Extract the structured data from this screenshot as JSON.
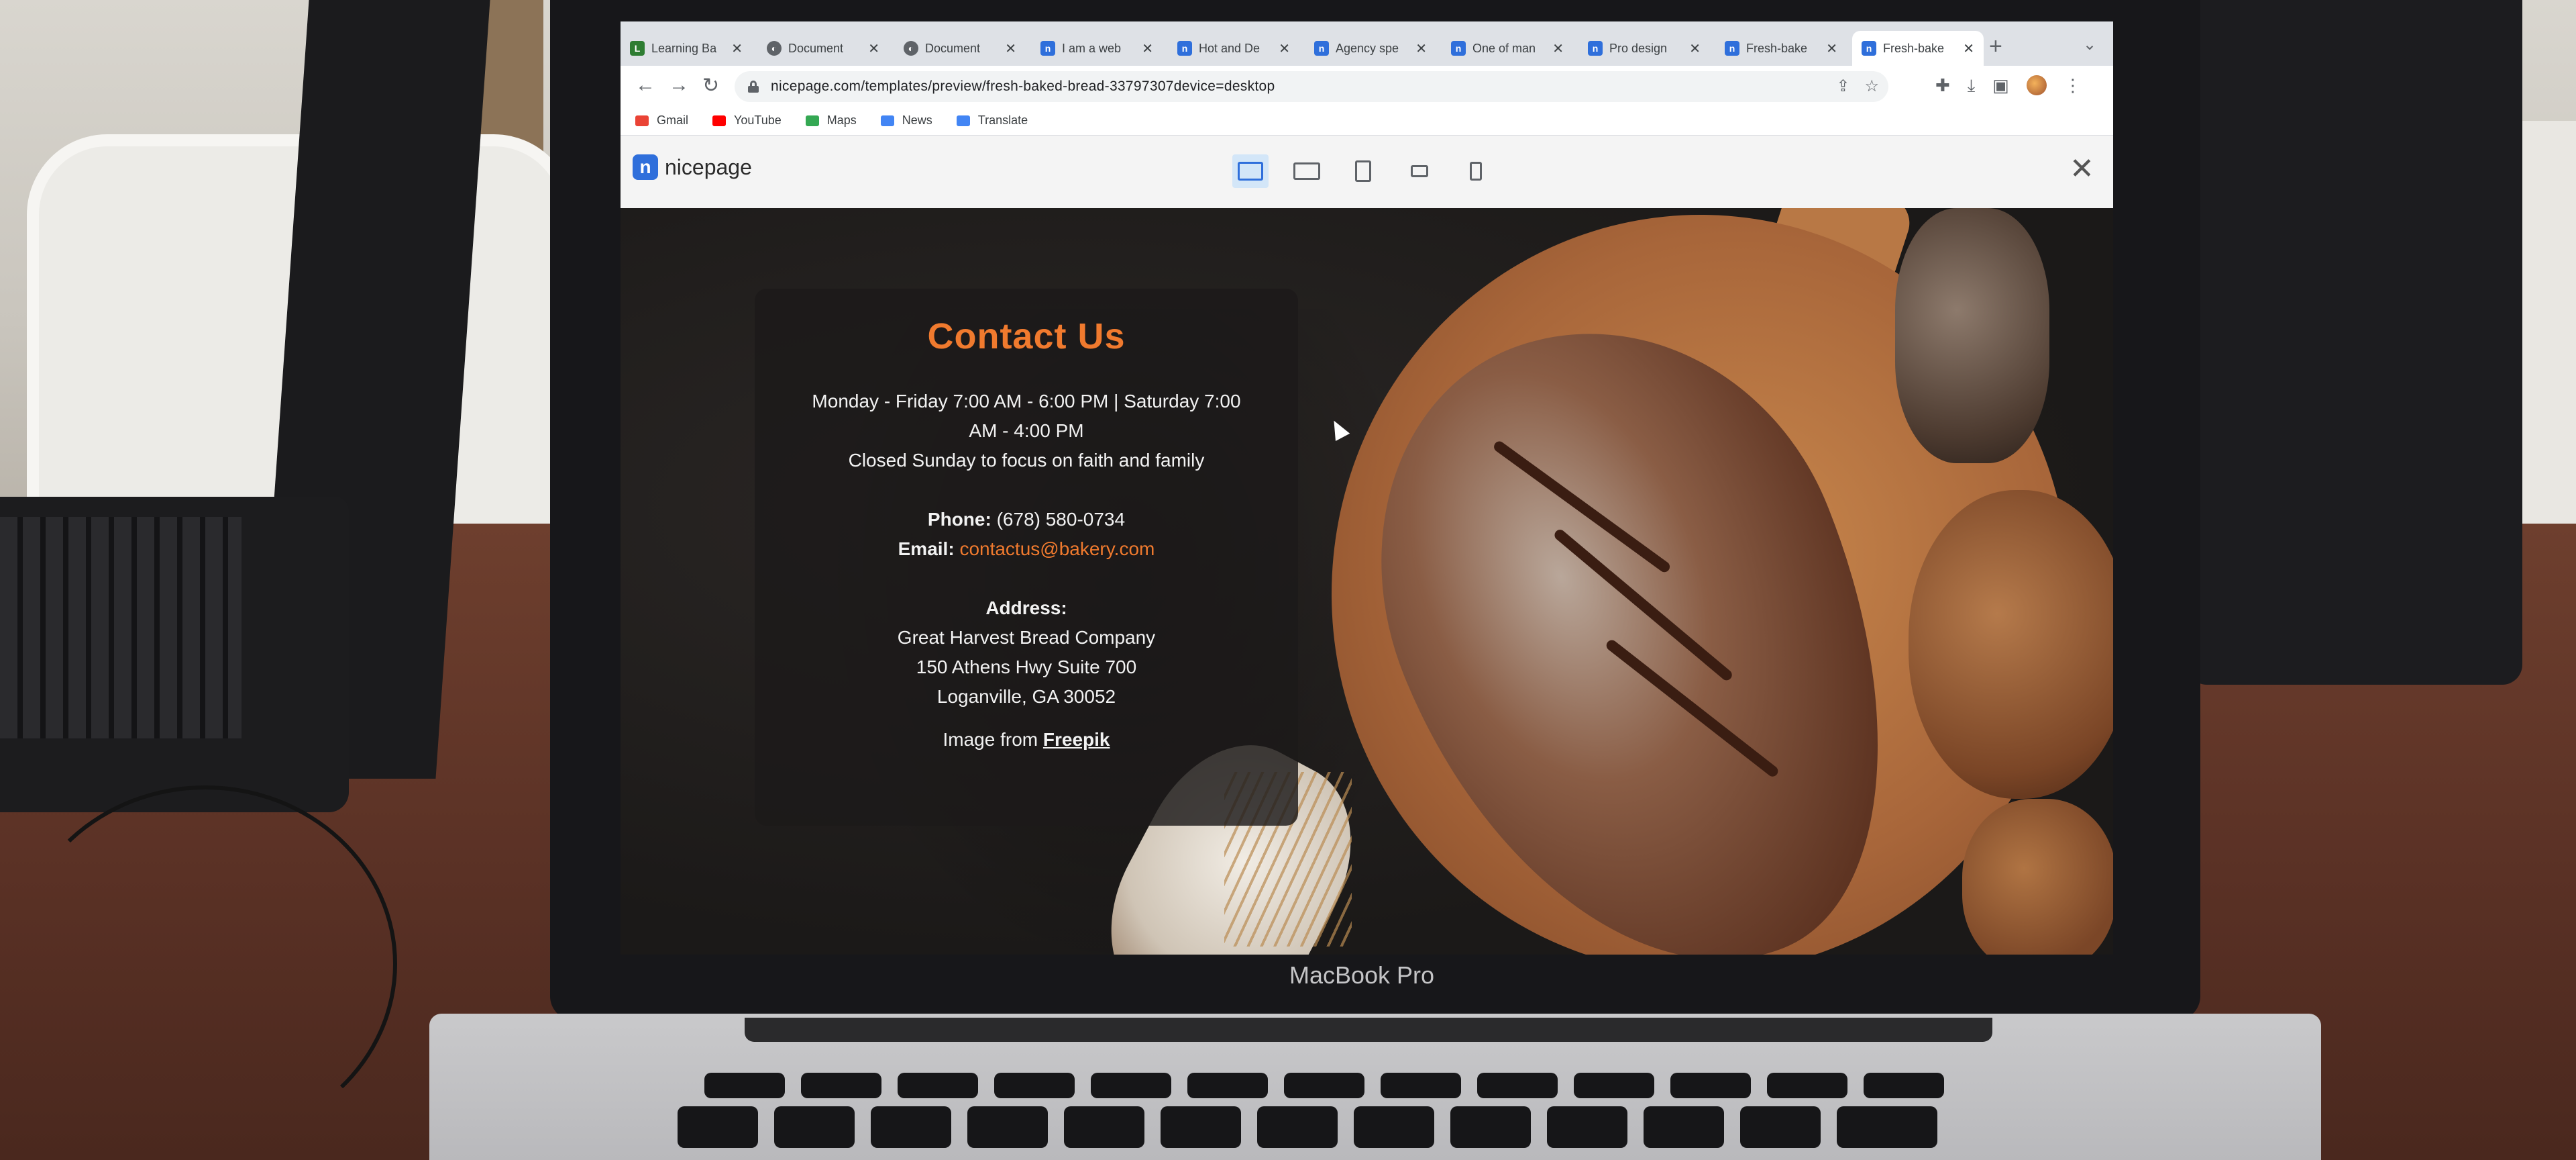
{
  "laptop": {
    "brand_label": "MacBook Pro"
  },
  "browser": {
    "tabs": [
      {
        "label": "Learning Ba",
        "icon": "learning-icon"
      },
      {
        "label": "Document",
        "icon": "globe-icon"
      },
      {
        "label": "Document",
        "icon": "globe-icon"
      },
      {
        "label": "I am a web",
        "icon": "nicepage-icon"
      },
      {
        "label": "Hot and De",
        "icon": "nicepage-icon"
      },
      {
        "label": "Agency spe",
        "icon": "nicepage-icon"
      },
      {
        "label": "One of man",
        "icon": "nicepage-icon"
      },
      {
        "label": "Pro design",
        "icon": "nicepage-icon"
      },
      {
        "label": "Fresh-bake",
        "icon": "nicepage-icon"
      },
      {
        "label": "Fresh-bake",
        "icon": "nicepage-icon",
        "active": true
      }
    ],
    "new_tab": "+",
    "url": "nicepage.com/templates/preview/fresh-baked-bread-33797307device=desktop",
    "bookmarks": [
      {
        "label": "Gmail",
        "color": "#ea4335"
      },
      {
        "label": "YouTube",
        "color": "#ff0000"
      },
      {
        "label": "Maps",
        "color": "#34a853"
      },
      {
        "label": "News",
        "color": "#4285f4"
      },
      {
        "label": "Translate",
        "color": "#4285f4"
      }
    ]
  },
  "nicepage": {
    "logo_text": "nicepage",
    "devices": [
      "desktop",
      "laptop",
      "tablet",
      "phone-landscape",
      "phone"
    ],
    "active_device": "desktop",
    "accent": "#2f6fdb"
  },
  "contact": {
    "title": "Contact Us",
    "hours_1": "Monday - Friday 7:00 AM - 6:00 PM | Saturday 7:00",
    "hours_2": "AM - 4:00 PM",
    "closed": "Closed Sunday to focus on faith and family",
    "phone_label": "Phone:",
    "phone": "(678) 580-0734",
    "email_label": "Email:",
    "email": "contactus@bakery.com",
    "address_label": "Address:",
    "address_1": "Great Harvest Bread Company",
    "address_2": "150 Athens Hwy Suite 700",
    "address_3": "Loganville, GA 30052",
    "image_credit_prefix": "Image from",
    "image_credit_link": "Freepik",
    "accent": "#f07a2e"
  }
}
